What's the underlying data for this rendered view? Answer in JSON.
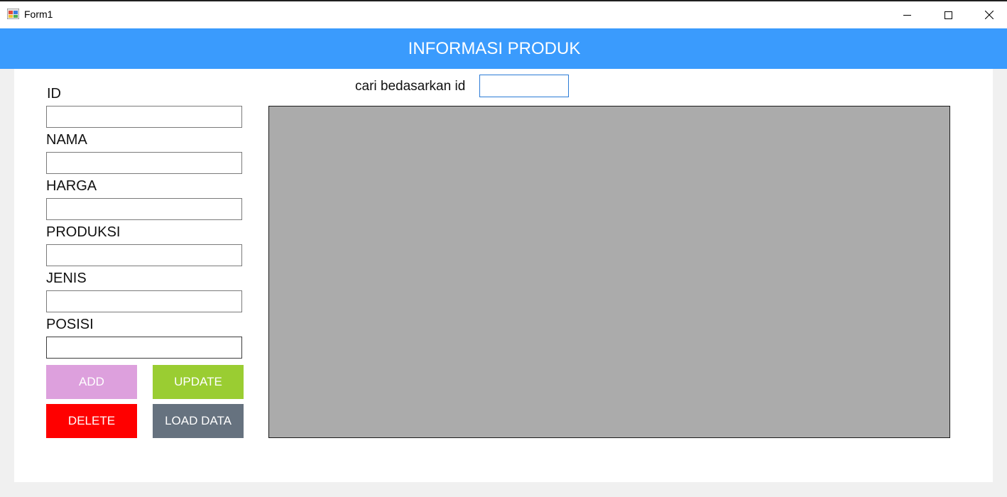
{
  "window": {
    "title": "Form1",
    "icon": "winforms-app-icon",
    "controls": {
      "minimize": "minimize-icon",
      "maximize": "maximize-icon",
      "close": "close-icon"
    }
  },
  "header": {
    "title": "INFORMASI PRODUK",
    "color": "#3a9bfd"
  },
  "form": {
    "fields": [
      {
        "label": "ID",
        "value": ""
      },
      {
        "label": "NAMA",
        "value": ""
      },
      {
        "label": "HARGA",
        "value": ""
      },
      {
        "label": "PRODUKSI",
        "value": ""
      },
      {
        "label": "JENIS",
        "value": ""
      },
      {
        "label": "POSISI",
        "value": ""
      }
    ],
    "buttons": {
      "add": {
        "label": "ADD",
        "color": "#dda0dd"
      },
      "update": {
        "label": "UPDATE",
        "color": "#9acd32"
      },
      "delete": {
        "label": "DELETE",
        "color": "#ff0000"
      },
      "load": {
        "label": "LOAD DATA",
        "color": "#66727f"
      }
    }
  },
  "search": {
    "label": "cari bedasarkan id",
    "value": ""
  },
  "grid": {
    "rows": [],
    "background": "#ababab"
  }
}
